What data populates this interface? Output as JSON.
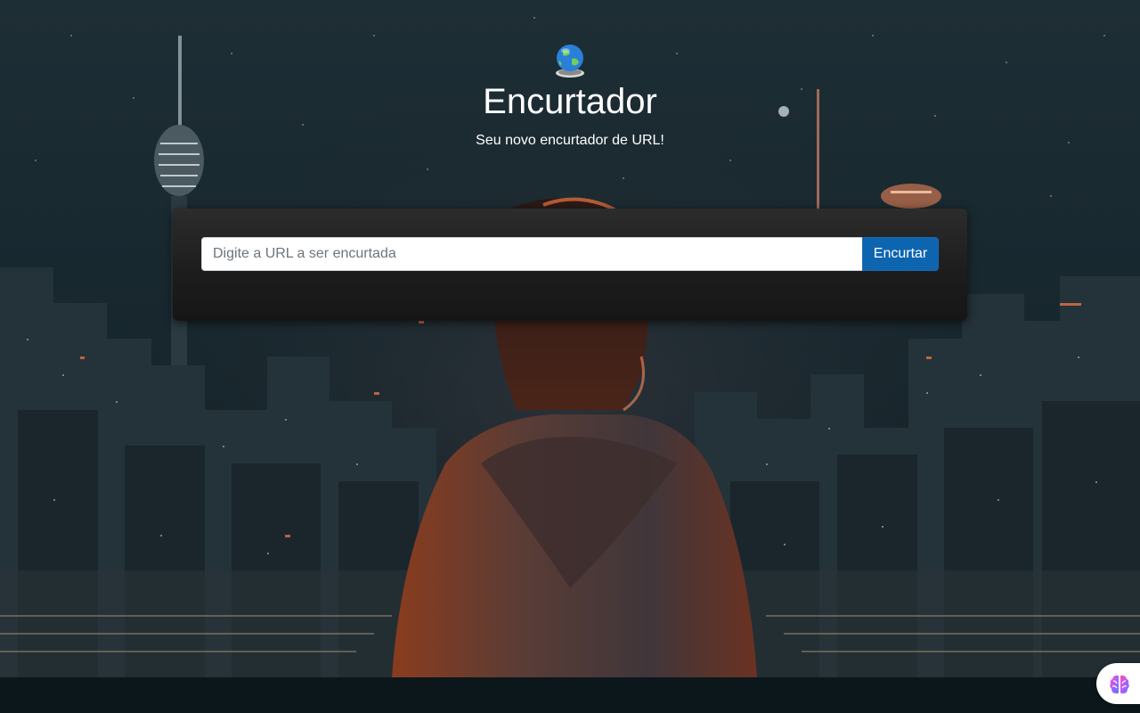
{
  "header": {
    "logo_icon": "globe-icon",
    "title": "Encurtador",
    "subtitle": "Seu novo encurtador de URL!"
  },
  "form": {
    "url_placeholder": "Digite a URL a ser encurtada",
    "url_value": "",
    "submit_label": "Encurtar"
  },
  "widget": {
    "icon": "brain-icon"
  },
  "colors": {
    "button": "#0d65b0",
    "card": "#242424",
    "text": "#ffffff"
  }
}
